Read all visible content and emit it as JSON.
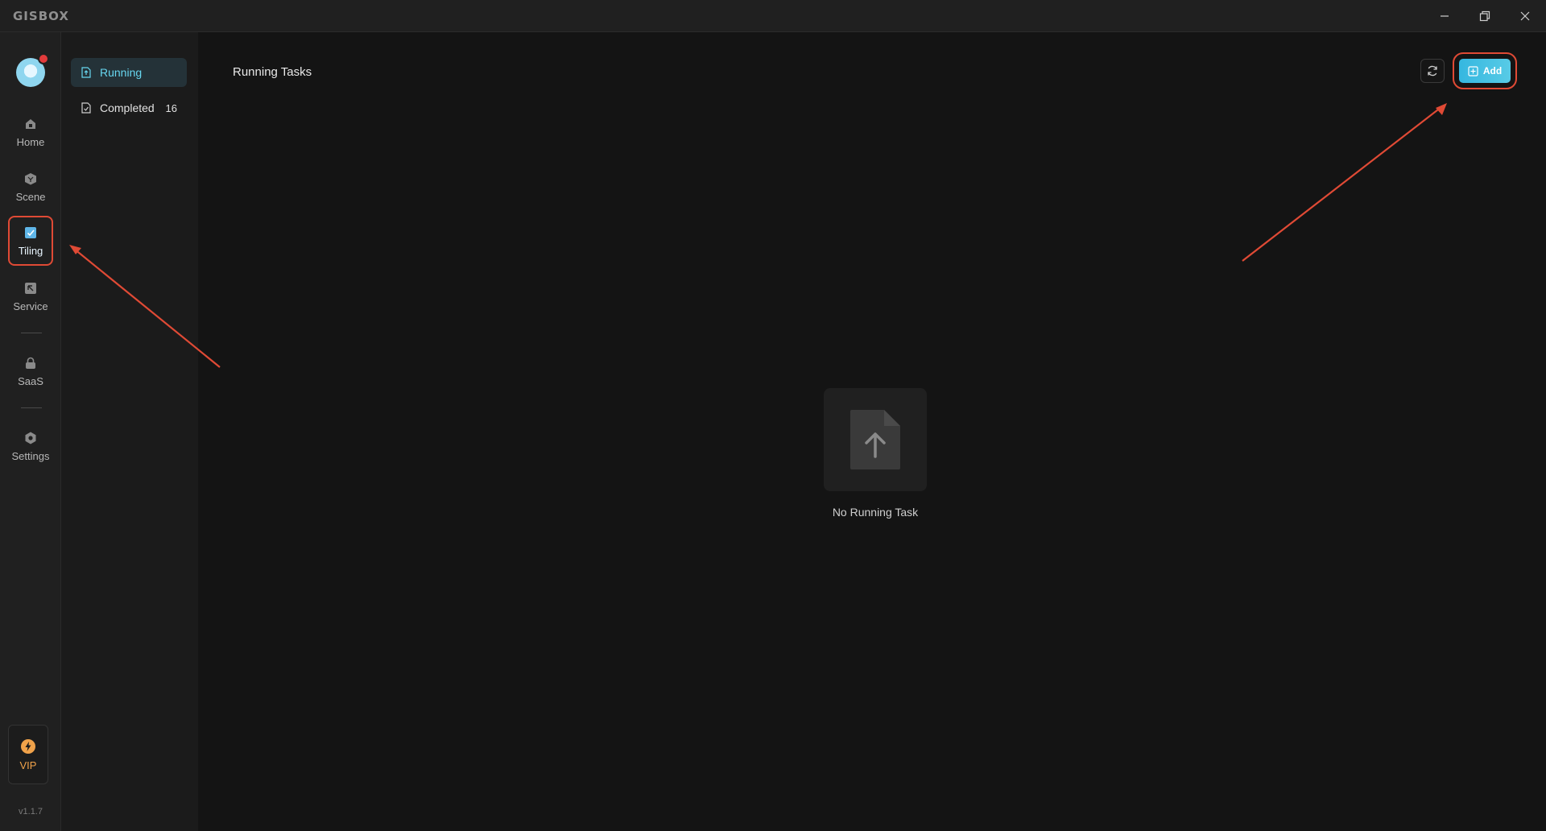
{
  "app": {
    "brand": "GISBOX"
  },
  "window_controls": {
    "minimize": "minimize-icon",
    "restore": "restore-icon",
    "close": "close-icon"
  },
  "rail": {
    "items": [
      {
        "label": "Home",
        "icon": "home-icon"
      },
      {
        "label": "Scene",
        "icon": "scene-icon"
      },
      {
        "label": "Tiling",
        "icon": "tiling-icon",
        "active": true
      },
      {
        "label": "Service",
        "icon": "service-icon"
      },
      {
        "label": "SaaS",
        "icon": "lock-icon"
      },
      {
        "label": "Settings",
        "icon": "gear-icon"
      }
    ],
    "vip_label": "VIP",
    "version": "v1.1.7"
  },
  "submenu": {
    "items": [
      {
        "label": "Running",
        "active": true
      },
      {
        "label": "Completed",
        "count": "16"
      }
    ]
  },
  "main": {
    "title": "Running Tasks",
    "add_label": "Add",
    "empty_text": "No Running Task"
  },
  "colors": {
    "accent": "#35b7e0",
    "annotation": "#e04a35",
    "vip": "#f0a24a"
  }
}
